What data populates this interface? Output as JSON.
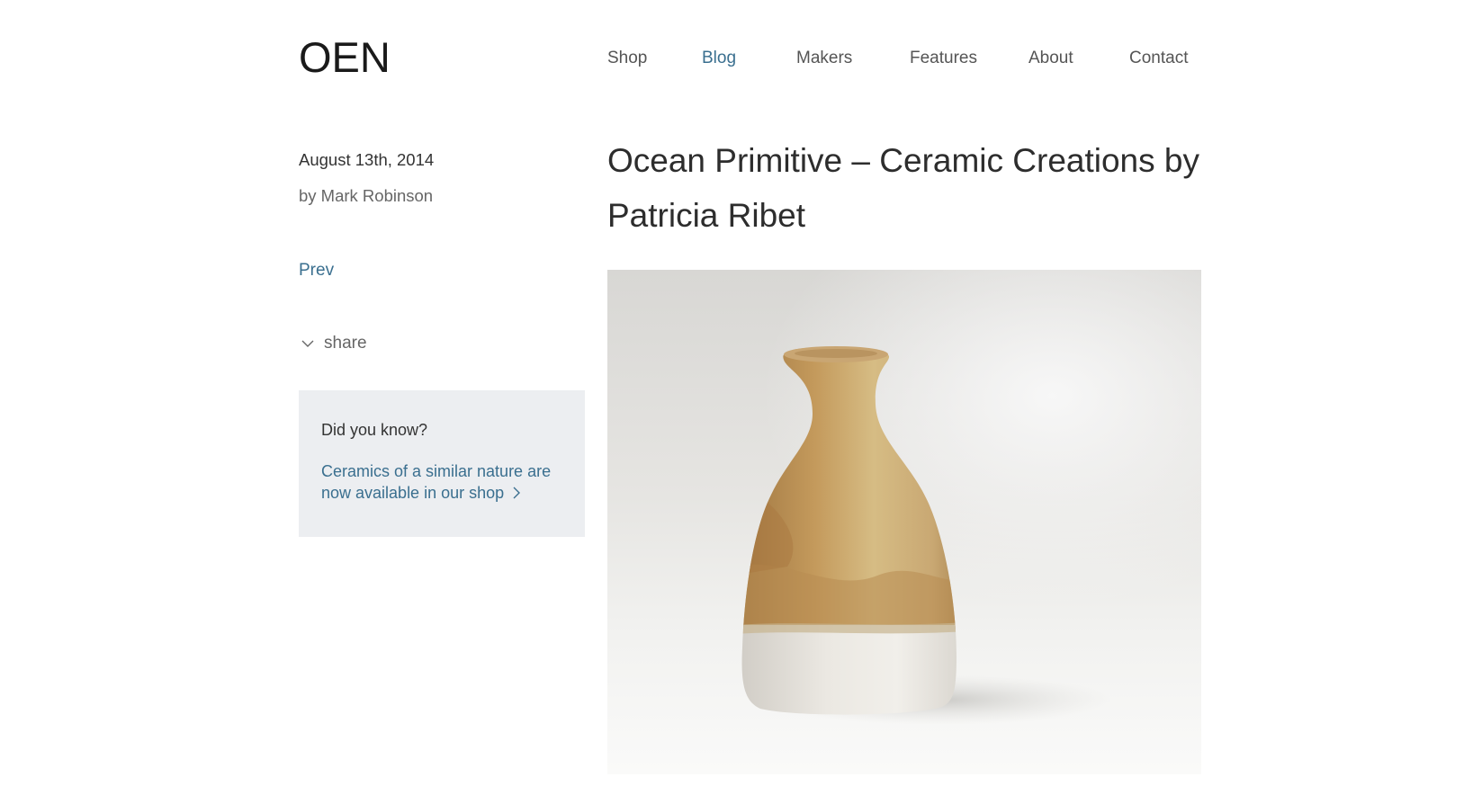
{
  "header": {
    "logo": "OEN",
    "nav": [
      {
        "label": "Shop"
      },
      {
        "label": "Blog",
        "active": true
      },
      {
        "label": "Makers"
      },
      {
        "label": "Features"
      },
      {
        "label": "About"
      },
      {
        "label": "Contact"
      }
    ]
  },
  "sidebar": {
    "date": "August 13th, 2014",
    "author": "by Mark Robinson",
    "prev_label": "Prev",
    "share_label": "share",
    "share_icon": "chevron-down-icon",
    "info_box": {
      "title": "Did you know?",
      "link_text": "Ceramics of a similar nature are now available in our shop",
      "link_icon": "chevron-right-icon"
    }
  },
  "article": {
    "title": "Ocean Primitive – Ceramic Creations by Patricia Ribet"
  },
  "colors": {
    "accent": "#3a6f8f",
    "text": "#3a3a3a",
    "info_box_bg": "#eceef1"
  }
}
